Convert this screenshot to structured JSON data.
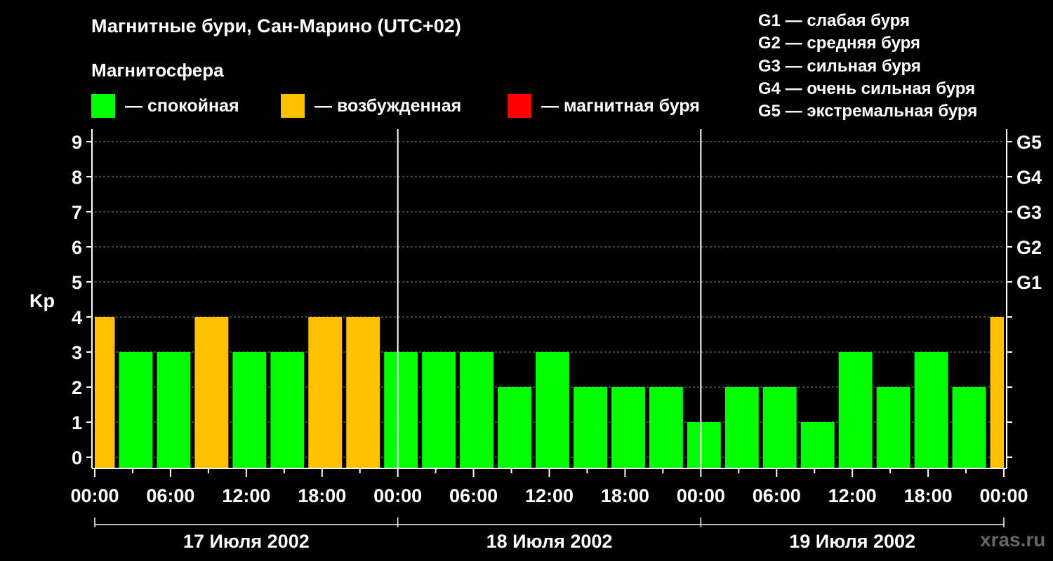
{
  "title": "Магнитные бури, Сан-Марино (UTC+02)",
  "subtitle": "Магнитосфера",
  "legend": [
    {
      "label": "— спокойная",
      "color": "#00ff00"
    },
    {
      "label": "— возбужденная",
      "color": "#ffc000"
    },
    {
      "label": "— магнитная буря",
      "color": "#ff0000"
    }
  ],
  "g_legend": [
    "G1 — слабая буря",
    "G2 — средняя буря",
    "G3 — сильная буря",
    "G4 — очень сильная буря",
    "G5 — экстремальная буря"
  ],
  "watermark": "xras.ru",
  "chart_data": {
    "type": "bar",
    "ylabel": "Kp",
    "ylim": [
      0,
      9
    ],
    "yticks": [
      0,
      1,
      2,
      3,
      4,
      5,
      6,
      7,
      8,
      9
    ],
    "right_axis_labels": [
      {
        "kp": 5,
        "label": "G1"
      },
      {
        "kp": 6,
        "label": "G2"
      },
      {
        "kp": 7,
        "label": "G3"
      },
      {
        "kp": 8,
        "label": "G4"
      },
      {
        "kp": 9,
        "label": "G5"
      }
    ],
    "x_hours_range": [
      0,
      72
    ],
    "xtick_labels": [
      "00:00",
      "06:00",
      "12:00",
      "18:00",
      "00:00",
      "06:00",
      "12:00",
      "18:00",
      "00:00",
      "06:00",
      "12:00",
      "18:00",
      "00:00"
    ],
    "days": [
      "17 Июля 2002",
      "18 Июля 2002",
      "19 Июля 2002"
    ],
    "grid": "horizontal dashed",
    "colors": {
      "quiet": "#00ff00",
      "active": "#ffc000",
      "storm": "#ff0000"
    },
    "bars": [
      {
        "start": 0,
        "end": 1.75,
        "kp": 4,
        "level": "active"
      },
      {
        "start": 1.75,
        "end": 4.75,
        "kp": 3,
        "level": "quiet"
      },
      {
        "start": 4.75,
        "end": 7.75,
        "kp": 3,
        "level": "quiet"
      },
      {
        "start": 7.75,
        "end": 10.75,
        "kp": 4,
        "level": "active"
      },
      {
        "start": 10.75,
        "end": 13.75,
        "kp": 3,
        "level": "quiet"
      },
      {
        "start": 13.75,
        "end": 16.75,
        "kp": 3,
        "level": "quiet"
      },
      {
        "start": 16.75,
        "end": 19.75,
        "kp": 4,
        "level": "active"
      },
      {
        "start": 19.75,
        "end": 22.75,
        "kp": 4,
        "level": "active"
      },
      {
        "start": 22.75,
        "end": 25.75,
        "kp": 3,
        "level": "quiet"
      },
      {
        "start": 25.75,
        "end": 28.75,
        "kp": 3,
        "level": "quiet"
      },
      {
        "start": 28.75,
        "end": 31.75,
        "kp": 3,
        "level": "quiet"
      },
      {
        "start": 31.75,
        "end": 34.75,
        "kp": 2,
        "level": "quiet"
      },
      {
        "start": 34.75,
        "end": 37.75,
        "kp": 3,
        "level": "quiet"
      },
      {
        "start": 37.75,
        "end": 40.75,
        "kp": 2,
        "level": "quiet"
      },
      {
        "start": 40.75,
        "end": 43.75,
        "kp": 2,
        "level": "quiet"
      },
      {
        "start": 43.75,
        "end": 46.75,
        "kp": 2,
        "level": "quiet"
      },
      {
        "start": 46.75,
        "end": 49.75,
        "kp": 1,
        "level": "quiet"
      },
      {
        "start": 49.75,
        "end": 52.75,
        "kp": 2,
        "level": "quiet"
      },
      {
        "start": 52.75,
        "end": 55.75,
        "kp": 2,
        "level": "quiet"
      },
      {
        "start": 55.75,
        "end": 58.75,
        "kp": 1,
        "level": "quiet"
      },
      {
        "start": 58.75,
        "end": 61.75,
        "kp": 3,
        "level": "quiet"
      },
      {
        "start": 61.75,
        "end": 64.75,
        "kp": 2,
        "level": "quiet"
      },
      {
        "start": 64.75,
        "end": 67.75,
        "kp": 3,
        "level": "quiet"
      },
      {
        "start": 67.75,
        "end": 70.75,
        "kp": 2,
        "level": "quiet"
      },
      {
        "start": 70.75,
        "end": 72,
        "kp": 4,
        "level": "active"
      }
    ]
  }
}
